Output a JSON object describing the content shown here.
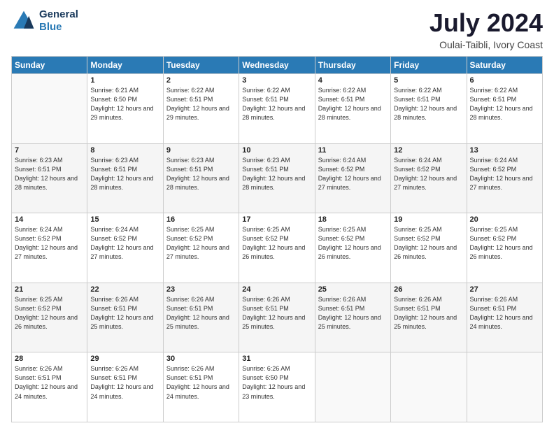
{
  "logo": {
    "line1": "General",
    "line2": "Blue"
  },
  "title": "July 2024",
  "location": "Oulai-Taibli, Ivory Coast",
  "days_header": [
    "Sunday",
    "Monday",
    "Tuesday",
    "Wednesday",
    "Thursday",
    "Friday",
    "Saturday"
  ],
  "weeks": [
    [
      {
        "day": "",
        "sunrise": "",
        "sunset": "",
        "daylight": ""
      },
      {
        "day": "1",
        "sunrise": "Sunrise: 6:21 AM",
        "sunset": "Sunset: 6:50 PM",
        "daylight": "Daylight: 12 hours and 29 minutes."
      },
      {
        "day": "2",
        "sunrise": "Sunrise: 6:22 AM",
        "sunset": "Sunset: 6:51 PM",
        "daylight": "Daylight: 12 hours and 29 minutes."
      },
      {
        "day": "3",
        "sunrise": "Sunrise: 6:22 AM",
        "sunset": "Sunset: 6:51 PM",
        "daylight": "Daylight: 12 hours and 28 minutes."
      },
      {
        "day": "4",
        "sunrise": "Sunrise: 6:22 AM",
        "sunset": "Sunset: 6:51 PM",
        "daylight": "Daylight: 12 hours and 28 minutes."
      },
      {
        "day": "5",
        "sunrise": "Sunrise: 6:22 AM",
        "sunset": "Sunset: 6:51 PM",
        "daylight": "Daylight: 12 hours and 28 minutes."
      },
      {
        "day": "6",
        "sunrise": "Sunrise: 6:22 AM",
        "sunset": "Sunset: 6:51 PM",
        "daylight": "Daylight: 12 hours and 28 minutes."
      }
    ],
    [
      {
        "day": "7",
        "sunrise": "Sunrise: 6:23 AM",
        "sunset": "Sunset: 6:51 PM",
        "daylight": "Daylight: 12 hours and 28 minutes."
      },
      {
        "day": "8",
        "sunrise": "Sunrise: 6:23 AM",
        "sunset": "Sunset: 6:51 PM",
        "daylight": "Daylight: 12 hours and 28 minutes."
      },
      {
        "day": "9",
        "sunrise": "Sunrise: 6:23 AM",
        "sunset": "Sunset: 6:51 PM",
        "daylight": "Daylight: 12 hours and 28 minutes."
      },
      {
        "day": "10",
        "sunrise": "Sunrise: 6:23 AM",
        "sunset": "Sunset: 6:51 PM",
        "daylight": "Daylight: 12 hours and 28 minutes."
      },
      {
        "day": "11",
        "sunrise": "Sunrise: 6:24 AM",
        "sunset": "Sunset: 6:52 PM",
        "daylight": "Daylight: 12 hours and 27 minutes."
      },
      {
        "day": "12",
        "sunrise": "Sunrise: 6:24 AM",
        "sunset": "Sunset: 6:52 PM",
        "daylight": "Daylight: 12 hours and 27 minutes."
      },
      {
        "day": "13",
        "sunrise": "Sunrise: 6:24 AM",
        "sunset": "Sunset: 6:52 PM",
        "daylight": "Daylight: 12 hours and 27 minutes."
      }
    ],
    [
      {
        "day": "14",
        "sunrise": "Sunrise: 6:24 AM",
        "sunset": "Sunset: 6:52 PM",
        "daylight": "Daylight: 12 hours and 27 minutes."
      },
      {
        "day": "15",
        "sunrise": "Sunrise: 6:24 AM",
        "sunset": "Sunset: 6:52 PM",
        "daylight": "Daylight: 12 hours and 27 minutes."
      },
      {
        "day": "16",
        "sunrise": "Sunrise: 6:25 AM",
        "sunset": "Sunset: 6:52 PM",
        "daylight": "Daylight: 12 hours and 27 minutes."
      },
      {
        "day": "17",
        "sunrise": "Sunrise: 6:25 AM",
        "sunset": "Sunset: 6:52 PM",
        "daylight": "Daylight: 12 hours and 26 minutes."
      },
      {
        "day": "18",
        "sunrise": "Sunrise: 6:25 AM",
        "sunset": "Sunset: 6:52 PM",
        "daylight": "Daylight: 12 hours and 26 minutes."
      },
      {
        "day": "19",
        "sunrise": "Sunrise: 6:25 AM",
        "sunset": "Sunset: 6:52 PM",
        "daylight": "Daylight: 12 hours and 26 minutes."
      },
      {
        "day": "20",
        "sunrise": "Sunrise: 6:25 AM",
        "sunset": "Sunset: 6:52 PM",
        "daylight": "Daylight: 12 hours and 26 minutes."
      }
    ],
    [
      {
        "day": "21",
        "sunrise": "Sunrise: 6:25 AM",
        "sunset": "Sunset: 6:52 PM",
        "daylight": "Daylight: 12 hours and 26 minutes."
      },
      {
        "day": "22",
        "sunrise": "Sunrise: 6:26 AM",
        "sunset": "Sunset: 6:51 PM",
        "daylight": "Daylight: 12 hours and 25 minutes."
      },
      {
        "day": "23",
        "sunrise": "Sunrise: 6:26 AM",
        "sunset": "Sunset: 6:51 PM",
        "daylight": "Daylight: 12 hours and 25 minutes."
      },
      {
        "day": "24",
        "sunrise": "Sunrise: 6:26 AM",
        "sunset": "Sunset: 6:51 PM",
        "daylight": "Daylight: 12 hours and 25 minutes."
      },
      {
        "day": "25",
        "sunrise": "Sunrise: 6:26 AM",
        "sunset": "Sunset: 6:51 PM",
        "daylight": "Daylight: 12 hours and 25 minutes."
      },
      {
        "day": "26",
        "sunrise": "Sunrise: 6:26 AM",
        "sunset": "Sunset: 6:51 PM",
        "daylight": "Daylight: 12 hours and 25 minutes."
      },
      {
        "day": "27",
        "sunrise": "Sunrise: 6:26 AM",
        "sunset": "Sunset: 6:51 PM",
        "daylight": "Daylight: 12 hours and 24 minutes."
      }
    ],
    [
      {
        "day": "28",
        "sunrise": "Sunrise: 6:26 AM",
        "sunset": "Sunset: 6:51 PM",
        "daylight": "Daylight: 12 hours and 24 minutes."
      },
      {
        "day": "29",
        "sunrise": "Sunrise: 6:26 AM",
        "sunset": "Sunset: 6:51 PM",
        "daylight": "Daylight: 12 hours and 24 minutes."
      },
      {
        "day": "30",
        "sunrise": "Sunrise: 6:26 AM",
        "sunset": "Sunset: 6:51 PM",
        "daylight": "Daylight: 12 hours and 24 minutes."
      },
      {
        "day": "31",
        "sunrise": "Sunrise: 6:26 AM",
        "sunset": "Sunset: 6:50 PM",
        "daylight": "Daylight: 12 hours and 23 minutes."
      },
      {
        "day": "",
        "sunrise": "",
        "sunset": "",
        "daylight": ""
      },
      {
        "day": "",
        "sunrise": "",
        "sunset": "",
        "daylight": ""
      },
      {
        "day": "",
        "sunrise": "",
        "sunset": "",
        "daylight": ""
      }
    ]
  ]
}
